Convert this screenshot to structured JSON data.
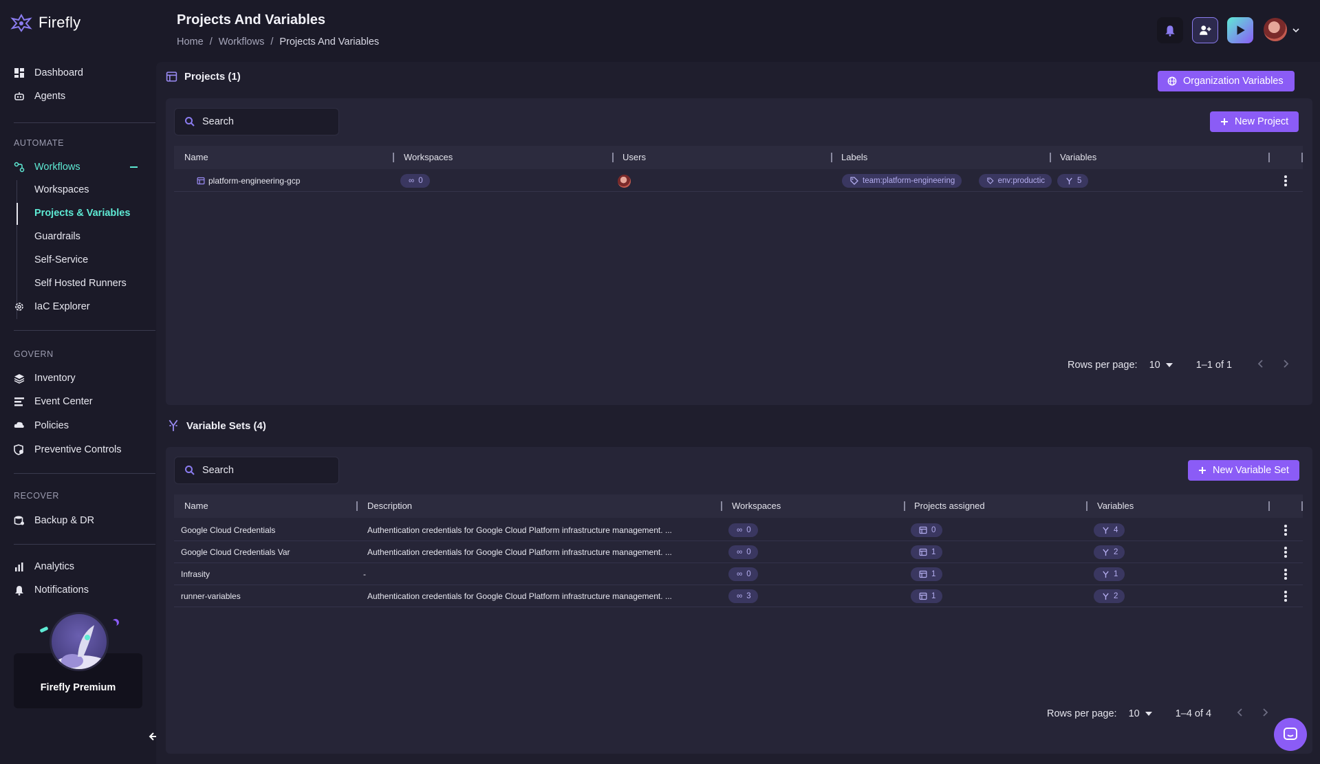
{
  "app": {
    "name": "Firefly"
  },
  "sidebar": {
    "top_items": [
      {
        "label": "Dashboard",
        "icon": "dashboard-icon"
      },
      {
        "label": "Agents",
        "icon": "robot-icon"
      }
    ],
    "automate_label": "AUTOMATE",
    "workflows_label": "Workflows",
    "workflow_subitems": [
      "Workspaces",
      "Projects & Variables",
      "Guardrails",
      "Self-Service",
      "Self Hosted Runners"
    ],
    "iac_explorer_label": "IaC Explorer",
    "govern_label": "GOVERN",
    "govern_items": [
      "Inventory",
      "Event Center",
      "Policies",
      "Preventive Controls"
    ],
    "recover_label": "RECOVER",
    "recover_items": [
      "Backup & DR"
    ],
    "bottom_items": [
      "Analytics",
      "Notifications"
    ],
    "premium_label": "Firefly Premium"
  },
  "header": {
    "title": "Projects And Variables",
    "breadcrumb": [
      "Home",
      "Workflows",
      "Projects And Variables"
    ],
    "breadcrumb_sep": "/"
  },
  "projects": {
    "title": "Projects (1)",
    "org_vars_button": "Organization Variables",
    "search_placeholder": "Search",
    "new_button": "New Project",
    "columns": [
      "Name",
      "Workspaces",
      "Users",
      "Labels",
      "Variables"
    ],
    "rows": [
      {
        "name": "platform-engineering-gcp",
        "workspaces": "0",
        "labels": [
          "team:platform-engineering",
          "env:productic"
        ],
        "variables": "5"
      }
    ],
    "rows_per_page_label": "Rows per page:",
    "rows_per_page": "10",
    "range": "1–1 of 1"
  },
  "variable_sets": {
    "title": "Variable Sets (4)",
    "search_placeholder": "Search",
    "new_button": "New Variable Set",
    "columns": [
      "Name",
      "Description",
      "Workspaces",
      "Projects assigned",
      "Variables"
    ],
    "rows": [
      {
        "name": "Google Cloud Credentials",
        "description": "Authentication credentials for Google Cloud Platform infrastructure management. ...",
        "workspaces": "0",
        "projects": "0",
        "variables": "4"
      },
      {
        "name": "Google Cloud Credentials Var",
        "description": "Authentication credentials for Google Cloud Platform infrastructure management. ...",
        "workspaces": "0",
        "projects": "1",
        "variables": "2"
      },
      {
        "name": "Infrasity",
        "description": "-",
        "workspaces": "0",
        "projects": "1",
        "variables": "1"
      },
      {
        "name": "runner-variables",
        "description": "Authentication credentials for Google Cloud Platform infrastructure management. ...",
        "workspaces": "3",
        "projects": "1",
        "variables": "2"
      }
    ],
    "rows_per_page_label": "Rows per page:",
    "rows_per_page": "10",
    "range": "1–4 of 4"
  },
  "colors": {
    "accent": "#8b5cf6",
    "active_nav": "#5eead4",
    "background": "#1b1a28",
    "panel": "#262537"
  }
}
